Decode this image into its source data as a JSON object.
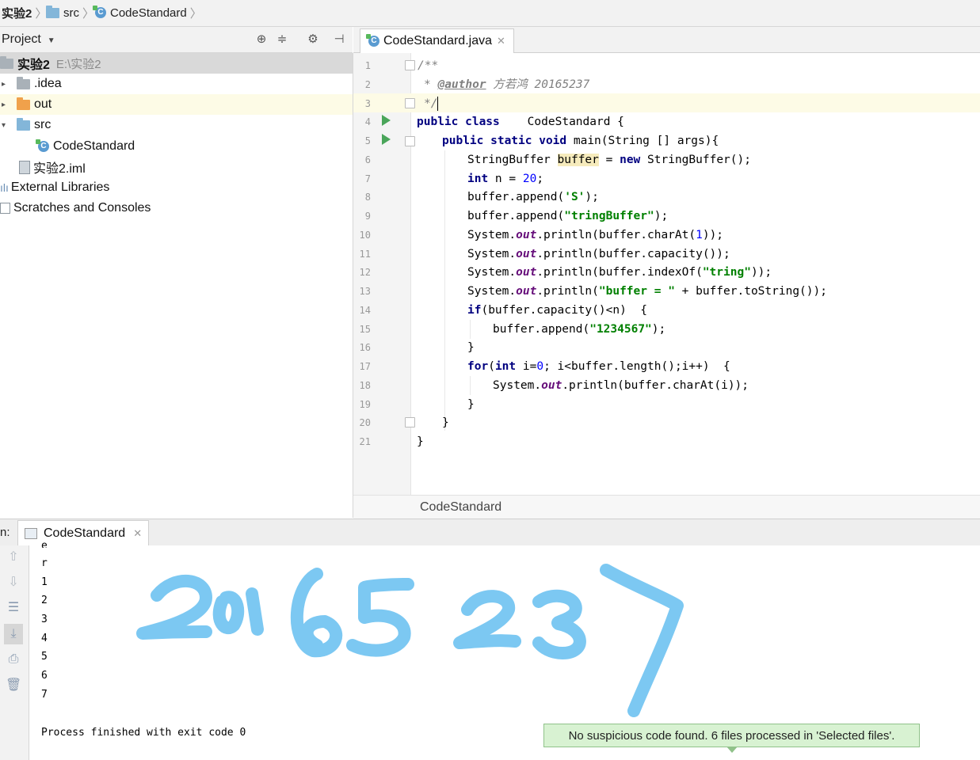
{
  "breadcrumb": {
    "items": [
      "实验2",
      "src",
      "CodeStandard"
    ]
  },
  "project_panel": {
    "title": "Project",
    "tree": [
      {
        "label": "实验2",
        "sub": "E:\\实验2"
      },
      {
        "label": ".idea"
      },
      {
        "label": "out"
      },
      {
        "label": "src"
      },
      {
        "label": "CodeStandard"
      },
      {
        "label": "实验2.iml"
      },
      {
        "label": "External Libraries"
      },
      {
        "label": "Scratches and Consoles"
      }
    ]
  },
  "editor": {
    "tab_label": "CodeStandard.java",
    "line_numbers": [
      "1",
      "2",
      "3",
      "4",
      "5",
      "6",
      "7",
      "8",
      "9",
      "10",
      "11",
      "12",
      "13",
      "14",
      "15",
      "16",
      "17",
      "18",
      "19",
      "20",
      "21"
    ],
    "code": {
      "l1": "/**",
      "l2_star": "* ",
      "l2_ann": "@author",
      "l2_rest": " 方若鸿 20165237",
      "l3": "*/",
      "l4_kw": "public class",
      "l4_rest": "    CodeStandard {",
      "l5_kw": "public static void",
      "l5_rest": " main(String [] args){",
      "l6_a": "StringBuffer ",
      "l6_var": "buffer",
      "l6_b": " = ",
      "l6_kw": "new",
      "l6_c": " StringBuffer();",
      "l7_kw": "int",
      "l7_a": " n = ",
      "l7_num": "20",
      "l7_b": ";",
      "l8_a": "buffer.append(",
      "l8_str": "'S'",
      "l8_b": ");",
      "l9_a": "buffer.append(",
      "l9_str": "\"tringBuffer\"",
      "l9_b": ");",
      "l10_a": "System.",
      "l10_f": "out",
      "l10_b": ".println(buffer.charAt(",
      "l10_num": "1",
      "l10_c": "));",
      "l11_a": "System.",
      "l11_f": "out",
      "l11_b": ".println(buffer.capacity());",
      "l12_a": "System.",
      "l12_f": "out",
      "l12_b": ".println(buffer.indexOf(",
      "l12_str": "\"tring\"",
      "l12_c": "));",
      "l13_a": "System.",
      "l13_f": "out",
      "l13_b": ".println(",
      "l13_str": "\"buffer = \"",
      "l13_c": " + buffer.toString());",
      "l14_kw": "if",
      "l14_rest": "(buffer.capacity()<n)  {",
      "l15_a": "buffer.append(",
      "l15_str": "\"1234567\"",
      "l15_b": ");",
      "l16": "}",
      "l17_kw": "for",
      "l17_a": "(",
      "l17_kw2": "int",
      "l17_b": " i=",
      "l17_num": "0",
      "l17_c": "; i<buffer.length();i++)  {",
      "l18_a": "System.",
      "l18_f": "out",
      "l18_b": ".println(buffer.charAt(i));",
      "l19": "}",
      "l20": "}",
      "l21": "}"
    },
    "footer_label": "CodeStandard"
  },
  "run_panel": {
    "label": "n:",
    "tab_label": "CodeStandard",
    "output": [
      "e",
      "r",
      "1",
      "2",
      "3",
      "4",
      "5",
      "6",
      "7",
      "",
      "Process finished with exit code 0"
    ]
  },
  "toast": "No suspicious code found. 6 files processed in 'Selected files'.",
  "colors": {
    "keyword": "#000080",
    "string": "#008000",
    "number": "#0000ff",
    "field": "#660e7a",
    "comment": "#808080",
    "scribble": "#7cc8f2",
    "toast_bg": "#d8f2d2"
  }
}
